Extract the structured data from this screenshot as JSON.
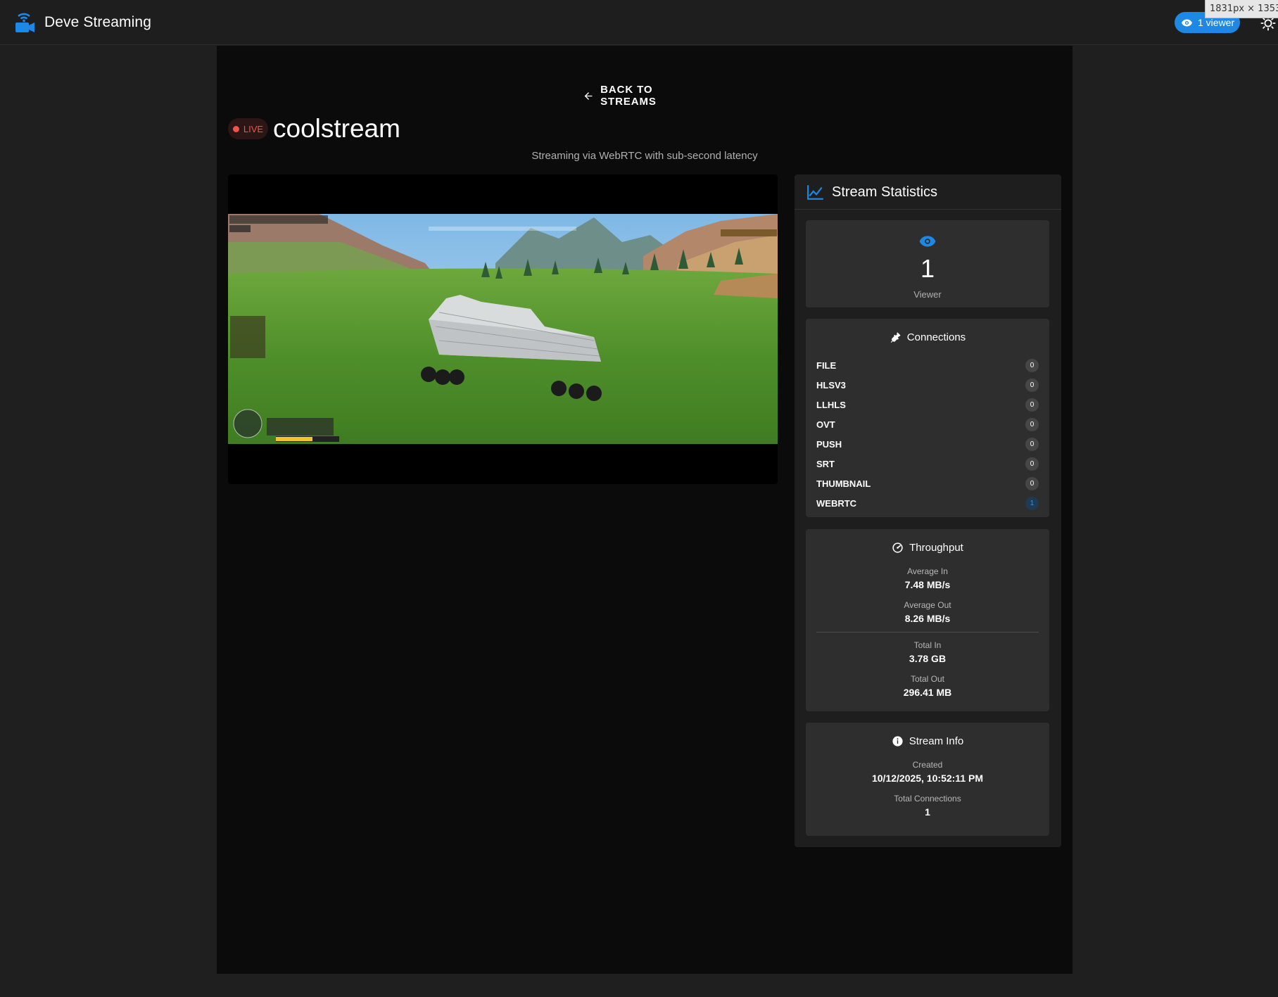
{
  "app": {
    "title": "Deve Streaming",
    "accent_color": "#1e88e5"
  },
  "header": {
    "viewer_chip_label": "1 viewer",
    "size_tooltip": "1831px × 1353px"
  },
  "page": {
    "back_label": "BACK TO STREAMS",
    "live_label": "LIVE",
    "stream_name": "coolstream",
    "subtitle": "Streaming via WebRTC with sub-second latency"
  },
  "stats": {
    "title": "Stream Statistics",
    "viewers": {
      "count": "1",
      "label": "Viewer"
    },
    "connections": {
      "title": "Connections",
      "items": [
        {
          "label": "FILE",
          "count": "0"
        },
        {
          "label": "HLSV3",
          "count": "0"
        },
        {
          "label": "LLHLS",
          "count": "0"
        },
        {
          "label": "OVT",
          "count": "0"
        },
        {
          "label": "PUSH",
          "count": "0"
        },
        {
          "label": "SRT",
          "count": "0"
        },
        {
          "label": "THUMBNAIL",
          "count": "0"
        },
        {
          "label": "WEBRTC",
          "count": "1"
        }
      ]
    },
    "throughput": {
      "title": "Throughput",
      "avg_in_label": "Average In",
      "avg_in_value": "7.48 MB/s",
      "avg_out_label": "Average Out",
      "avg_out_value": "8.26 MB/s",
      "total_in_label": "Total In",
      "total_in_value": "3.78 GB",
      "total_out_label": "Total Out",
      "total_out_value": "296.41 MB"
    },
    "info": {
      "title": "Stream Info",
      "created_label": "Created",
      "created_value": "10/12/2025, 10:52:11 PM",
      "total_connections_label": "Total Connections",
      "total_connections_value": "1"
    }
  }
}
